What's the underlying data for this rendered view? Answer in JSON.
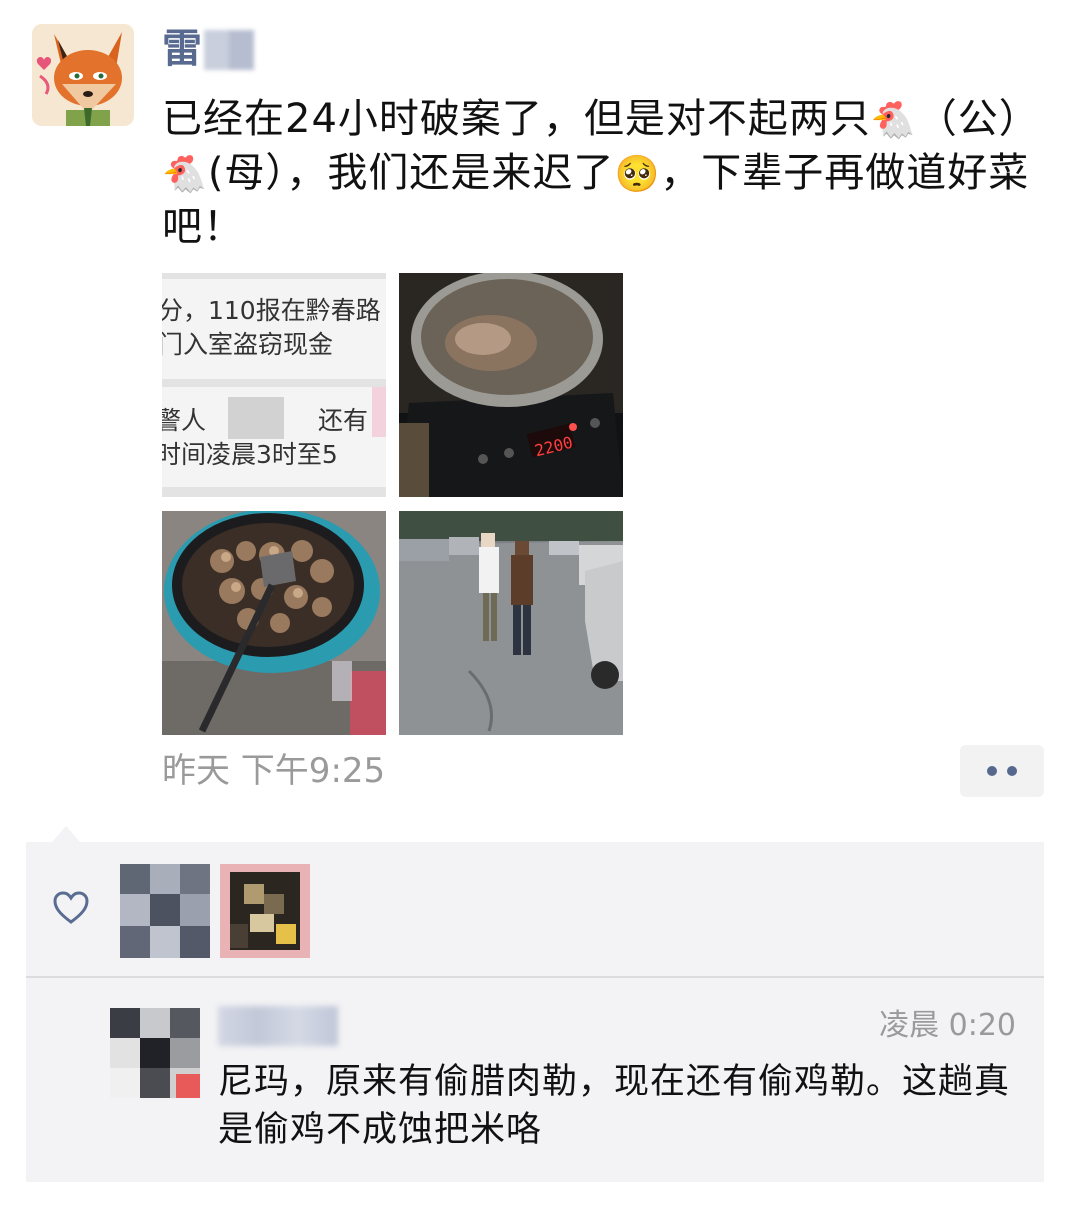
{
  "post": {
    "author_name": "雷",
    "text_part1": "已经在24小时破案了，但是对不起两只",
    "chicken_emoji": "🐔",
    "text_part2": "（公）",
    "text_part3": "(母），我们还是来迟了",
    "sad_emoji": "🥺",
    "text_part4": "，下辈子再做道好菜吧！",
    "photos": [
      {
        "id": "photo-1",
        "caption_line1": "分，110报在黔春路",
        "caption_line2": "门入室盗窃现金",
        "caption_line3": "警人",
        "caption_line4": "还有",
        "caption_line5": "时间凌晨3时至5"
      },
      {
        "id": "photo-2",
        "display": "2200"
      },
      {
        "id": "photo-3"
      },
      {
        "id": "photo-4"
      }
    ],
    "timestamp": "昨天 下午9:25"
  },
  "comment": {
    "time": "凌晨 0:20",
    "text": "尼玛，原来有偷腊肉勒，现在还有偷鸡勒。这趟真是偷鸡不成蚀把米咯"
  }
}
